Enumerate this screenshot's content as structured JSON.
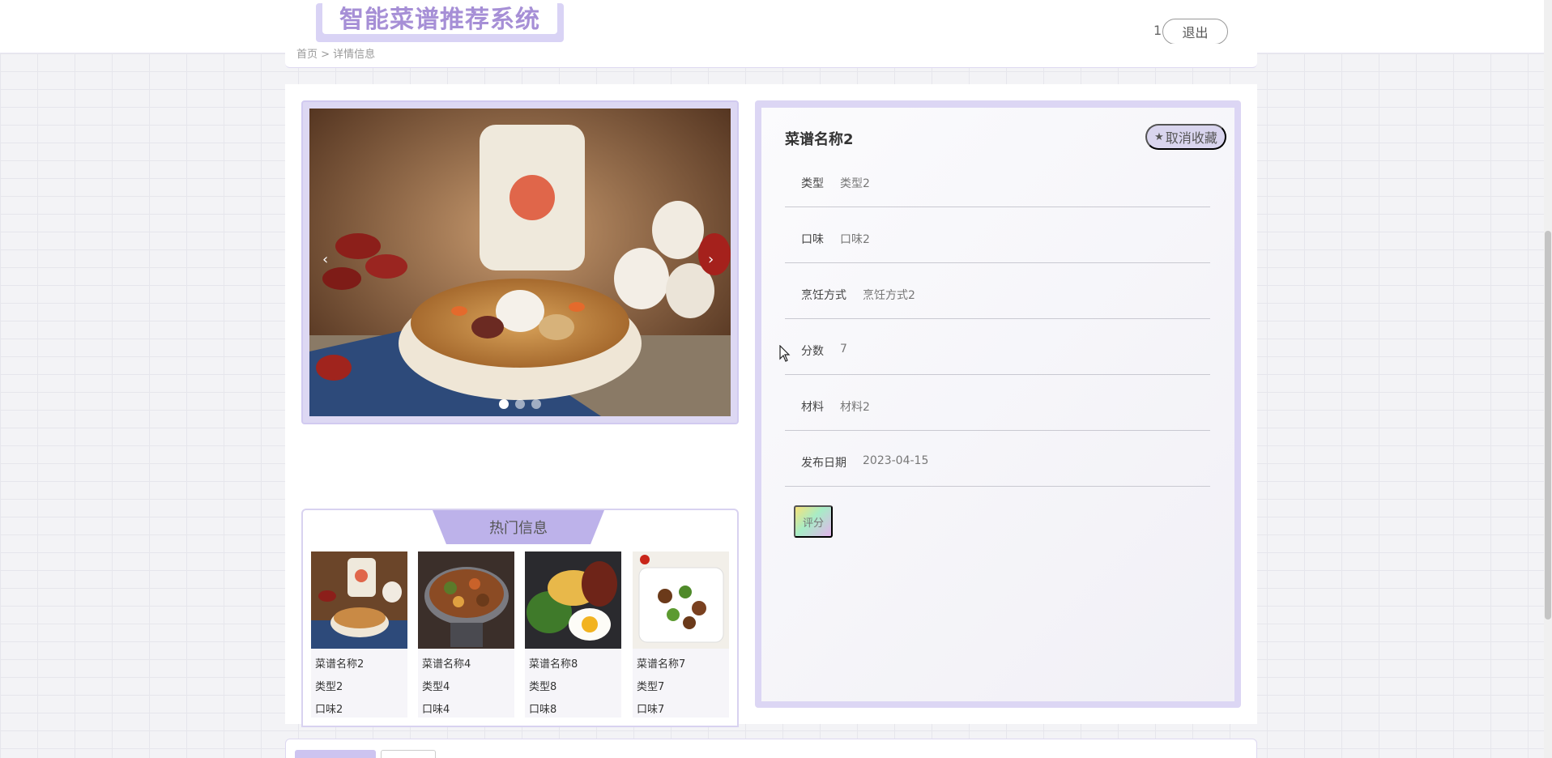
{
  "header": {
    "brand": "智能菜谱推荐系统",
    "user": "1",
    "logout_label": "退出",
    "breadcrumb": "首页 > 详情信息"
  },
  "detail": {
    "title": "菜谱名称2",
    "unfavorite_label": "取消收藏",
    "fields": [
      {
        "label": "类型",
        "value": "类型2"
      },
      {
        "label": "口味",
        "value": "口味2"
      },
      {
        "label": "烹饪方式",
        "value": "烹饪方式2"
      },
      {
        "label": "分数",
        "value": "7"
      },
      {
        "label": "材料",
        "value": "材料2"
      },
      {
        "label": "发布日期",
        "value": "2023-04-15"
      }
    ],
    "rate_label": "评分"
  },
  "carousel": {
    "prev": "‹",
    "next": "›",
    "slide_count": 3,
    "active_index": 0
  },
  "hot": {
    "title": "热门信息",
    "cards": [
      {
        "name": "菜谱名称2",
        "type": "类型2",
        "taste": "口味2"
      },
      {
        "name": "菜谱名称4",
        "type": "类型4",
        "taste": "口味4"
      },
      {
        "name": "菜谱名称8",
        "type": "类型8",
        "taste": "口味8"
      },
      {
        "name": "菜谱名称7",
        "type": "类型7",
        "taste": "口味7"
      }
    ]
  },
  "colors": {
    "accent": "#bdb2ea",
    "brand_text": "#a68fd6",
    "frame": "#dcd6f4"
  }
}
